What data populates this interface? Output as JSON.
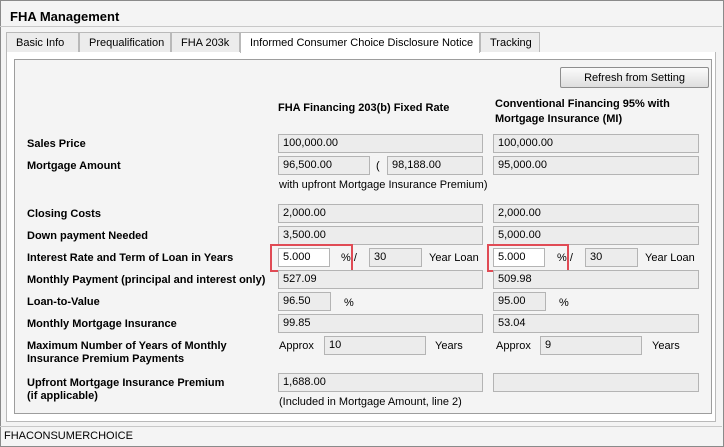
{
  "window": {
    "title": "FHA Management"
  },
  "tabs": [
    "Basic Info",
    "Prequalification",
    "FHA 203k",
    "Informed Consumer Choice Disclosure Notice",
    "Tracking"
  ],
  "active_tab": "Informed Consumer Choice Disclosure Notice",
  "refresh_button": "Refresh from Setting",
  "columns": {
    "fha": "FHA Financing 203(b) Fixed Rate",
    "conv_line1": "Conventional Financing 95% with",
    "conv_line2": "Mortgage Insurance (MI)"
  },
  "rows": {
    "sales_price": {
      "label": "Sales Price",
      "fha": "100,000.00",
      "conv": "100,000.00"
    },
    "mortgage_amount": {
      "label": "Mortgage Amount",
      "fha": "96,500.00",
      "paren": "(",
      "fha_with_mip": "98,188.00",
      "conv": "95,000.00",
      "note": "with upfront Mortgage Insurance Premium)"
    },
    "closing_costs": {
      "label": "Closing Costs",
      "fha": "2,000.00",
      "conv": "2,000.00"
    },
    "down_payment": {
      "label": "Down payment Needed",
      "fha": "3,500.00",
      "conv": "5,000.00"
    },
    "interest_rate": {
      "label": "Interest Rate and Term of Loan in Years",
      "fha_rate": "5.000",
      "fha_term": "30",
      "conv_rate": "5.000",
      "conv_term": "30",
      "pct_sep": "% /",
      "year_loan": "Year Loan"
    },
    "monthly_payment": {
      "label": "Monthly Payment (principal and interest only)",
      "fha": "527.09",
      "conv": "509.98"
    },
    "ltv": {
      "label": "Loan-to-Value",
      "fha": "96.50",
      "conv": "95.00",
      "pct": "%"
    },
    "monthly_mi": {
      "label": "Monthly Mortgage Insurance",
      "fha": "99.85",
      "conv": "53.04"
    },
    "max_years": {
      "label_line1": "Maximum Number of Years of Monthly",
      "label_line2": "Insurance Premium Payments",
      "approx": "Approx",
      "fha": "10",
      "conv": "9",
      "years": "Years"
    },
    "upfront_mip": {
      "label_line1": "Upfront Mortgage Insurance Premium",
      "label_line2": "(if applicable)",
      "fha": "1,688.00",
      "conv": "",
      "note": "(Included in Mortgage Amount, line 2)"
    }
  },
  "footer": "FHACONSUMERCHOICE",
  "colors": {
    "highlight": "#e04b55"
  }
}
